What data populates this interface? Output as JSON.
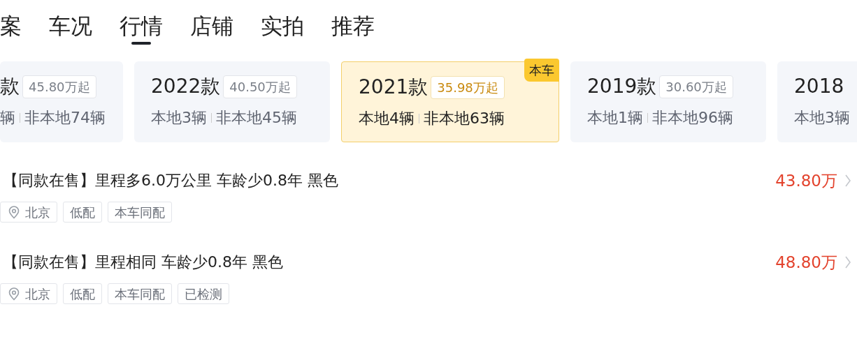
{
  "tabs": [
    {
      "label": "案",
      "selected": false
    },
    {
      "label": "车况",
      "selected": false
    },
    {
      "label": "行情",
      "selected": true
    },
    {
      "label": "店铺",
      "selected": false
    },
    {
      "label": "实拍",
      "selected": false
    },
    {
      "label": "推荐",
      "selected": false
    }
  ],
  "model_years": [
    {
      "year": "款",
      "price_tag": "45.80万起",
      "local": "辆",
      "nonlocal": "非本地74辆",
      "selected": false
    },
    {
      "year": "2022款",
      "price_tag": "40.50万起",
      "local": "本地3辆",
      "nonlocal": "非本地45辆",
      "selected": false
    },
    {
      "year": "2021款",
      "price_tag": "35.98万起",
      "local": "本地4辆",
      "nonlocal": "非本地63辆",
      "selected": true,
      "badge": "本车"
    },
    {
      "year": "2019款",
      "price_tag": "30.60万起",
      "local": "本地1辆",
      "nonlocal": "非本地96辆",
      "selected": false
    },
    {
      "year": "2018",
      "local": "本地3辆",
      "selected": false
    }
  ],
  "listings": [
    {
      "title": "【同款在售】里程多6.0万公里 车龄少0.8年 黑色",
      "price": "43.80万",
      "tags": [
        {
          "kind": "location",
          "label": "北京"
        },
        {
          "kind": "plain",
          "label": "低配"
        },
        {
          "kind": "plain",
          "label": "本车同配"
        }
      ]
    },
    {
      "title": "【同款在售】里程相同 车龄少0.8年 黑色",
      "price": "48.80万",
      "tags": [
        {
          "kind": "location",
          "label": "北京"
        },
        {
          "kind": "plain",
          "label": "低配"
        },
        {
          "kind": "plain",
          "label": "本车同配"
        },
        {
          "kind": "plain",
          "label": "已检测"
        }
      ]
    }
  ]
}
